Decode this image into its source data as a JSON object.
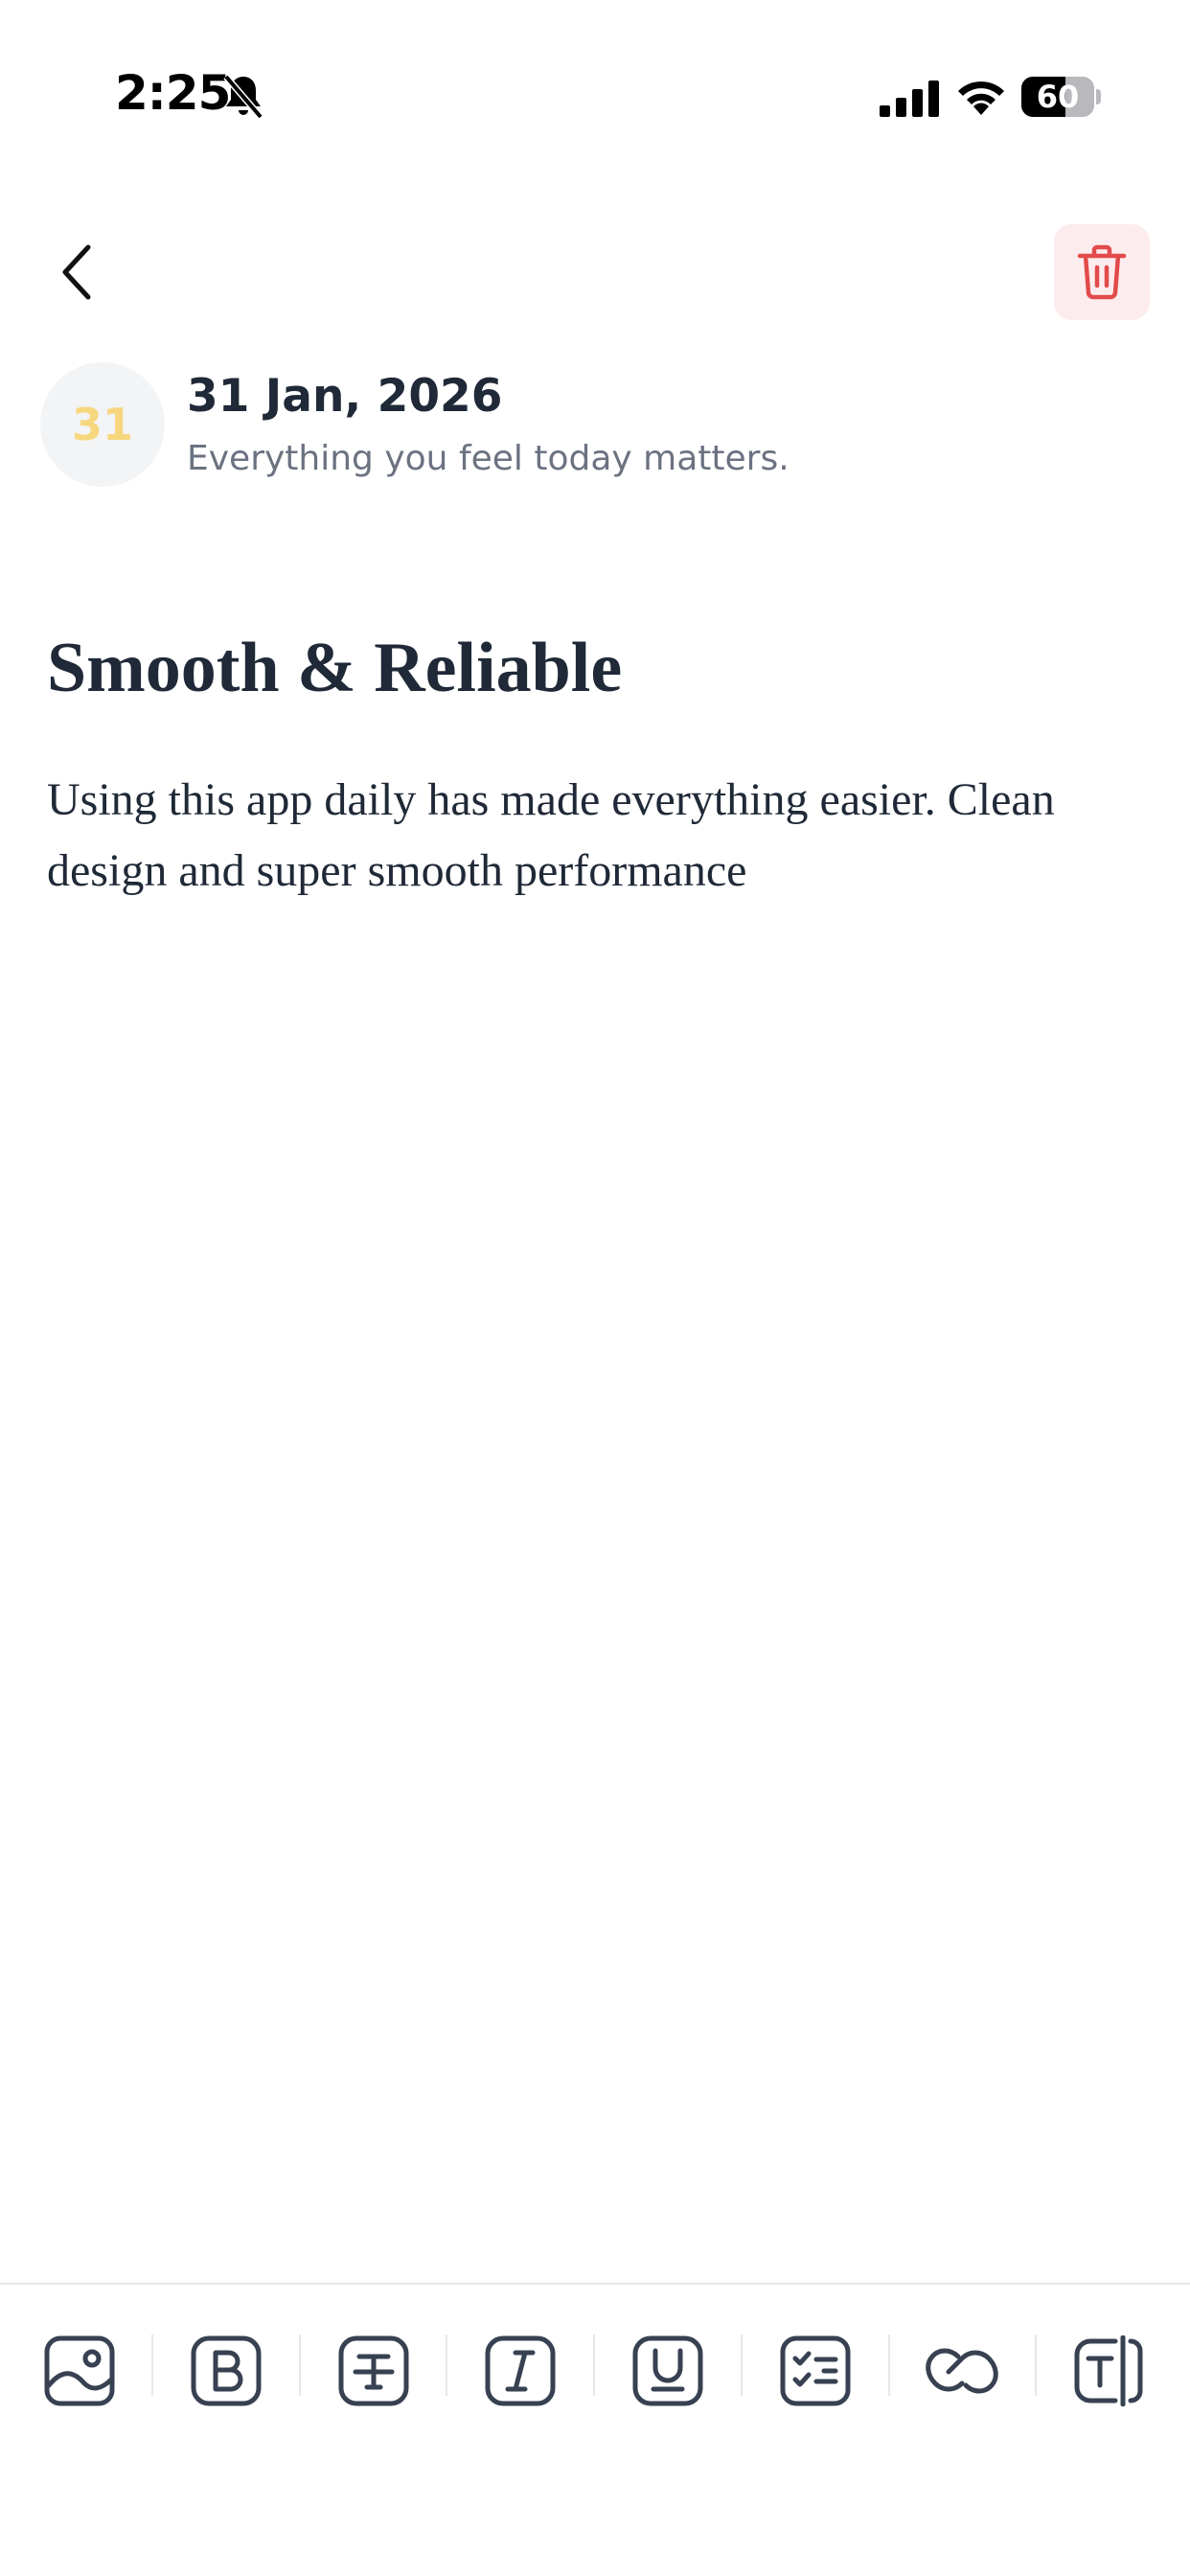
{
  "status_bar": {
    "time": "2:25",
    "battery_percent": "60",
    "battery_level": 0.6
  },
  "header": {
    "back_icon": "chevron-left-icon",
    "delete_icon": "trash-icon",
    "delete_bg_color": "#fdeced",
    "delete_icon_color": "#e24b4b"
  },
  "entry": {
    "day_number": "31",
    "date": "31 Jan, 2026",
    "subtitle": "Everything you feel today matters.",
    "title": "Smooth & Reliable",
    "body": "Using this app daily has made everything easier. Clean design and super smooth performance"
  },
  "toolbar": {
    "tools": [
      {
        "name": "image-icon"
      },
      {
        "name": "bold-icon"
      },
      {
        "name": "strikethrough-icon"
      },
      {
        "name": "italic-icon"
      },
      {
        "name": "underline-icon"
      },
      {
        "name": "checklist-icon"
      },
      {
        "name": "link-icon"
      },
      {
        "name": "text-cursor-icon"
      }
    ]
  },
  "colors": {
    "accent_yellow": "#f7d77e",
    "text_dark": "#1f2937",
    "text_muted": "#6b7280",
    "icon_dark": "#374151"
  }
}
